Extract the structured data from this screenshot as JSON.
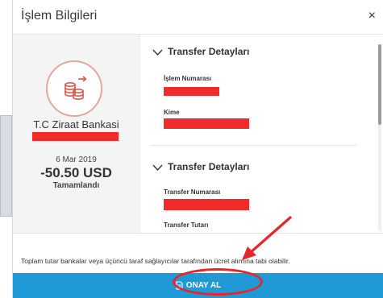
{
  "modal": {
    "title": "İşlem Bilgileri",
    "close": "×"
  },
  "summary": {
    "bank_name": "T.C Ziraat Bankasi",
    "date": "6 Mar 2019",
    "amount": "-50.50 USD",
    "status": "Tamamlandı"
  },
  "sections": [
    {
      "title": "Transfer Detayları",
      "fields": [
        {
          "label": "İşlem Numarası"
        },
        {
          "label": "Kime"
        }
      ]
    },
    {
      "title": "Transfer Detayları",
      "fields": [
        {
          "label": "Transfer Numarası"
        },
        {
          "label": "Transfer Tutarı"
        }
      ]
    }
  ],
  "footer": {
    "note": "Toplam tutar bankalar veya üçüncü taraf sağlayıcılar tarafından ücret alımına tabi olabilir.",
    "confirm_label": "ONAY AL"
  },
  "colors": {
    "accent_blue": "#1f9ad6",
    "redaction_red": "#ef2b2b",
    "annotation_red": "#e8262a"
  },
  "icons": {
    "bank": "coins-transfer-icon",
    "chevron": "chevron-down-icon",
    "confirm": "document-icon",
    "close": "close-icon"
  }
}
